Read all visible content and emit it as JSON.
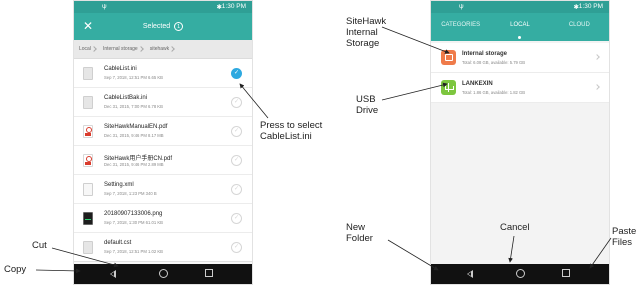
{
  "phone_a": {
    "status": {
      "signal": "ψ",
      "bluetooth": "✱",
      "time": "1:30 PM"
    },
    "header": {
      "title": "Selected",
      "count": "1",
      "close_glyph": "✕"
    },
    "breadcrumbs": [
      "Local",
      "Internal storage",
      "sitehawk"
    ],
    "files": [
      {
        "name": "CableList.ini",
        "meta": "Sep 7, 2018, 12:51 PM 6.65 KB",
        "type": "txt",
        "selected": true
      },
      {
        "name": "CableListBak.ini",
        "meta": "Dec 31, 2015, 7:00 PM 6.78 KB",
        "type": "txt",
        "selected": false
      },
      {
        "name": "SiteHawkManualEN.pdf",
        "meta": "Dec 31, 2015, 9:46 PM 8.17 MB",
        "type": "pdf",
        "selected": false
      },
      {
        "name": "SiteHawk用户手册CN.pdf",
        "meta": "Dec 31, 2015, 9:46 PM 2.89 MB",
        "type": "pdf",
        "selected": false
      },
      {
        "name": "Setting.xml",
        "meta": "Sep 7, 2018, 1:23 PM 340 B",
        "type": "xml",
        "selected": false
      },
      {
        "name": "20180907133006.png",
        "meta": "Sep 7, 2018, 1:30 PM 61.01 KB",
        "type": "img",
        "selected": false
      },
      {
        "name": "default.cst",
        "meta": "Sep 7, 2018, 12:51 PM 1.02 KB",
        "type": "txt",
        "selected": false
      }
    ],
    "toolbar_icons": [
      "copy-icon",
      "cut-icon",
      "delete-icon",
      "select-all-icon",
      "menu-icon"
    ]
  },
  "phone_b": {
    "status": {
      "signal": "ψ",
      "bluetooth": "✱",
      "time": "1:30 PM"
    },
    "tabs": [
      {
        "label": "CATEGORIES",
        "active": false
      },
      {
        "label": "LOCAL",
        "active": true
      },
      {
        "label": "CLOUD",
        "active": false
      }
    ],
    "storages": [
      {
        "name": "Internal storage",
        "meta": "Total: 6.08 GB, available: 5.79 GB",
        "kind": "internal"
      },
      {
        "name": "LANKEXIN",
        "meta": "Total: 1.86 GB, available: 1.82 GB",
        "kind": "usb"
      }
    ],
    "toolbar_icons": [
      "new-folder-icon",
      "cancel-icon",
      "paste-icon"
    ]
  },
  "annotations": {
    "copy": "Copy",
    "cut": "Cut",
    "press_select_1": "Press to select",
    "press_select_2": "CableList.ini",
    "sitehawk_1": "SiteHawk",
    "sitehawk_2": "Internal",
    "sitehawk_3": "Storage",
    "usb_1": "USB",
    "usb_2": "Drive",
    "new_folder_1": "New",
    "new_folder_2": "Folder",
    "cancel": "Cancel",
    "paste_1": "Paste",
    "paste_2": "Files"
  },
  "colors": {
    "teal": "#35ada2",
    "teal_dark": "#2f9f95",
    "check_blue": "#2ea9e0",
    "internal_orange": "#ef7b4a",
    "usb_green": "#7dc63f"
  }
}
